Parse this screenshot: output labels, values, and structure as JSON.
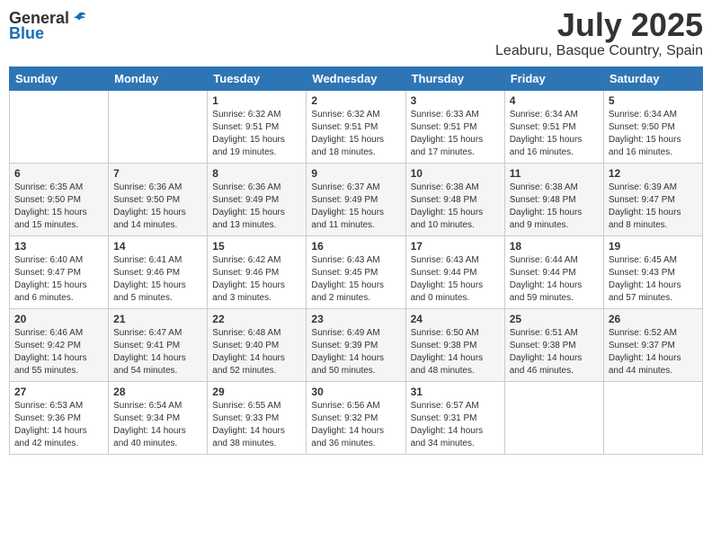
{
  "header": {
    "logo_general": "General",
    "logo_blue": "Blue",
    "month": "July 2025",
    "location": "Leaburu, Basque Country, Spain"
  },
  "days_of_week": [
    "Sunday",
    "Monday",
    "Tuesday",
    "Wednesday",
    "Thursday",
    "Friday",
    "Saturday"
  ],
  "weeks": [
    [
      {
        "day": "",
        "sunrise": "",
        "sunset": "",
        "daylight": ""
      },
      {
        "day": "",
        "sunrise": "",
        "sunset": "",
        "daylight": ""
      },
      {
        "day": "1",
        "sunrise": "Sunrise: 6:32 AM",
        "sunset": "Sunset: 9:51 PM",
        "daylight": "Daylight: 15 hours and 19 minutes."
      },
      {
        "day": "2",
        "sunrise": "Sunrise: 6:32 AM",
        "sunset": "Sunset: 9:51 PM",
        "daylight": "Daylight: 15 hours and 18 minutes."
      },
      {
        "day": "3",
        "sunrise": "Sunrise: 6:33 AM",
        "sunset": "Sunset: 9:51 PM",
        "daylight": "Daylight: 15 hours and 17 minutes."
      },
      {
        "day": "4",
        "sunrise": "Sunrise: 6:34 AM",
        "sunset": "Sunset: 9:51 PM",
        "daylight": "Daylight: 15 hours and 16 minutes."
      },
      {
        "day": "5",
        "sunrise": "Sunrise: 6:34 AM",
        "sunset": "Sunset: 9:50 PM",
        "daylight": "Daylight: 15 hours and 16 minutes."
      }
    ],
    [
      {
        "day": "6",
        "sunrise": "Sunrise: 6:35 AM",
        "sunset": "Sunset: 9:50 PM",
        "daylight": "Daylight: 15 hours and 15 minutes."
      },
      {
        "day": "7",
        "sunrise": "Sunrise: 6:36 AM",
        "sunset": "Sunset: 9:50 PM",
        "daylight": "Daylight: 15 hours and 14 minutes."
      },
      {
        "day": "8",
        "sunrise": "Sunrise: 6:36 AM",
        "sunset": "Sunset: 9:49 PM",
        "daylight": "Daylight: 15 hours and 13 minutes."
      },
      {
        "day": "9",
        "sunrise": "Sunrise: 6:37 AM",
        "sunset": "Sunset: 9:49 PM",
        "daylight": "Daylight: 15 hours and 11 minutes."
      },
      {
        "day": "10",
        "sunrise": "Sunrise: 6:38 AM",
        "sunset": "Sunset: 9:48 PM",
        "daylight": "Daylight: 15 hours and 10 minutes."
      },
      {
        "day": "11",
        "sunrise": "Sunrise: 6:38 AM",
        "sunset": "Sunset: 9:48 PM",
        "daylight": "Daylight: 15 hours and 9 minutes."
      },
      {
        "day": "12",
        "sunrise": "Sunrise: 6:39 AM",
        "sunset": "Sunset: 9:47 PM",
        "daylight": "Daylight: 15 hours and 8 minutes."
      }
    ],
    [
      {
        "day": "13",
        "sunrise": "Sunrise: 6:40 AM",
        "sunset": "Sunset: 9:47 PM",
        "daylight": "Daylight: 15 hours and 6 minutes."
      },
      {
        "day": "14",
        "sunrise": "Sunrise: 6:41 AM",
        "sunset": "Sunset: 9:46 PM",
        "daylight": "Daylight: 15 hours and 5 minutes."
      },
      {
        "day": "15",
        "sunrise": "Sunrise: 6:42 AM",
        "sunset": "Sunset: 9:46 PM",
        "daylight": "Daylight: 15 hours and 3 minutes."
      },
      {
        "day": "16",
        "sunrise": "Sunrise: 6:43 AM",
        "sunset": "Sunset: 9:45 PM",
        "daylight": "Daylight: 15 hours and 2 minutes."
      },
      {
        "day": "17",
        "sunrise": "Sunrise: 6:43 AM",
        "sunset": "Sunset: 9:44 PM",
        "daylight": "Daylight: 15 hours and 0 minutes."
      },
      {
        "day": "18",
        "sunrise": "Sunrise: 6:44 AM",
        "sunset": "Sunset: 9:44 PM",
        "daylight": "Daylight: 14 hours and 59 minutes."
      },
      {
        "day": "19",
        "sunrise": "Sunrise: 6:45 AM",
        "sunset": "Sunset: 9:43 PM",
        "daylight": "Daylight: 14 hours and 57 minutes."
      }
    ],
    [
      {
        "day": "20",
        "sunrise": "Sunrise: 6:46 AM",
        "sunset": "Sunset: 9:42 PM",
        "daylight": "Daylight: 14 hours and 55 minutes."
      },
      {
        "day": "21",
        "sunrise": "Sunrise: 6:47 AM",
        "sunset": "Sunset: 9:41 PM",
        "daylight": "Daylight: 14 hours and 54 minutes."
      },
      {
        "day": "22",
        "sunrise": "Sunrise: 6:48 AM",
        "sunset": "Sunset: 9:40 PM",
        "daylight": "Daylight: 14 hours and 52 minutes."
      },
      {
        "day": "23",
        "sunrise": "Sunrise: 6:49 AM",
        "sunset": "Sunset: 9:39 PM",
        "daylight": "Daylight: 14 hours and 50 minutes."
      },
      {
        "day": "24",
        "sunrise": "Sunrise: 6:50 AM",
        "sunset": "Sunset: 9:38 PM",
        "daylight": "Daylight: 14 hours and 48 minutes."
      },
      {
        "day": "25",
        "sunrise": "Sunrise: 6:51 AM",
        "sunset": "Sunset: 9:38 PM",
        "daylight": "Daylight: 14 hours and 46 minutes."
      },
      {
        "day": "26",
        "sunrise": "Sunrise: 6:52 AM",
        "sunset": "Sunset: 9:37 PM",
        "daylight": "Daylight: 14 hours and 44 minutes."
      }
    ],
    [
      {
        "day": "27",
        "sunrise": "Sunrise: 6:53 AM",
        "sunset": "Sunset: 9:36 PM",
        "daylight": "Daylight: 14 hours and 42 minutes."
      },
      {
        "day": "28",
        "sunrise": "Sunrise: 6:54 AM",
        "sunset": "Sunset: 9:34 PM",
        "daylight": "Daylight: 14 hours and 40 minutes."
      },
      {
        "day": "29",
        "sunrise": "Sunrise: 6:55 AM",
        "sunset": "Sunset: 9:33 PM",
        "daylight": "Daylight: 14 hours and 38 minutes."
      },
      {
        "day": "30",
        "sunrise": "Sunrise: 6:56 AM",
        "sunset": "Sunset: 9:32 PM",
        "daylight": "Daylight: 14 hours and 36 minutes."
      },
      {
        "day": "31",
        "sunrise": "Sunrise: 6:57 AM",
        "sunset": "Sunset: 9:31 PM",
        "daylight": "Daylight: 14 hours and 34 minutes."
      },
      {
        "day": "",
        "sunrise": "",
        "sunset": "",
        "daylight": ""
      },
      {
        "day": "",
        "sunrise": "",
        "sunset": "",
        "daylight": ""
      }
    ]
  ]
}
